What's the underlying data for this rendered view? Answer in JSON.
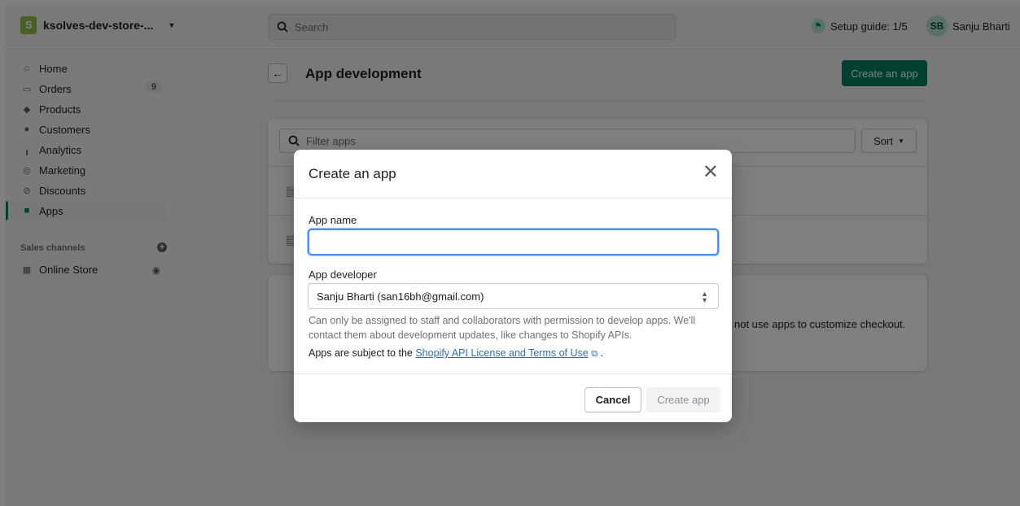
{
  "topbar": {
    "store_name": "ksolves-dev-store-...",
    "search_placeholder": "Search",
    "setup_guide": "Setup guide: 1/5",
    "user_initials": "SB",
    "user_name": "Sanju Bharti"
  },
  "sidebar": {
    "items": [
      {
        "label": "Home",
        "icon": "home-icon"
      },
      {
        "label": "Orders",
        "icon": "orders-icon",
        "badge": "9"
      },
      {
        "label": "Products",
        "icon": "tag-icon"
      },
      {
        "label": "Customers",
        "icon": "person-icon"
      },
      {
        "label": "Analytics",
        "icon": "bar-chart-icon"
      },
      {
        "label": "Marketing",
        "icon": "target-icon"
      },
      {
        "label": "Discounts",
        "icon": "discount-icon"
      },
      {
        "label": "Apps",
        "icon": "apps-icon",
        "active": true
      }
    ],
    "channels_label": "Sales channels",
    "online_store": "Online Store"
  },
  "main": {
    "title": "App development",
    "create_button": "Create an app",
    "filter_placeholder": "Filter apps",
    "sort_label": "Sort",
    "notice_text": "not use apps to customize checkout."
  },
  "modal": {
    "title": "Create an app",
    "app_name_label": "App name",
    "app_name_value": "",
    "developer_label": "App developer",
    "developer_value": "Sanju Bharti (san16bh@gmail.com)",
    "help_text": "Can only be assigned to staff and collaborators with permission to develop apps. We'll contact them about development updates, like changes to Shopify APIs.",
    "terms_prefix": "Apps are subject to the",
    "terms_link": "Shopify API License and Terms of Use",
    "terms_suffix": ".",
    "cancel_label": "Cancel",
    "create_label": "Create app"
  },
  "colors": {
    "accent": "#008060",
    "link": "#2c6ecb",
    "focus": "#458fff"
  }
}
